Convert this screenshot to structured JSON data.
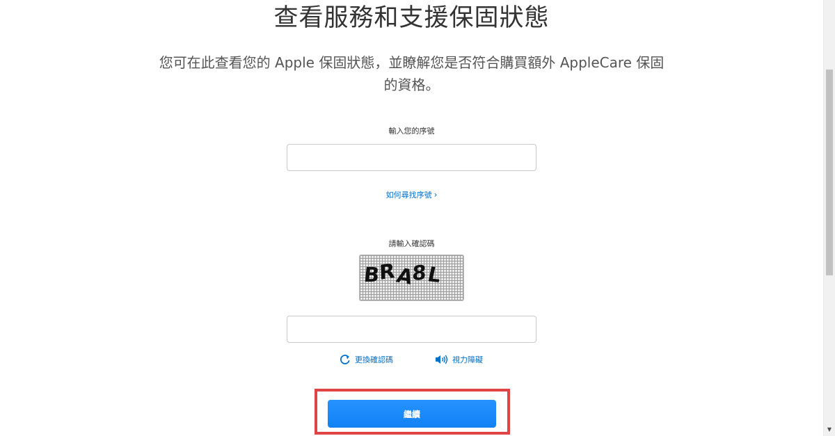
{
  "page": {
    "title": "查看服務和支援保固狀態",
    "intro": "您可在此查看您的 Apple 保固狀態，並瞭解您是否符合購買額外 AppleCare 保固的資格。"
  },
  "serial": {
    "label": "輸入您的序號",
    "value": "",
    "placeholder": "",
    "find_link": "如何尋找序號",
    "find_link_chevron": "›"
  },
  "captcha": {
    "label": "請輸入確認碼",
    "image_text": "BRA8L",
    "value": "",
    "placeholder": "",
    "refresh_label": "更換確認碼",
    "audio_label": "視力障礙",
    "refresh_icon": "refresh-icon",
    "audio_icon": "speaker-icon"
  },
  "actions": {
    "continue_label": "繼續"
  },
  "colors": {
    "link": "#0070c9",
    "button": "#1a8cff",
    "highlight": "#e04545"
  },
  "scrollbar": {
    "down_arrow": "▼"
  }
}
